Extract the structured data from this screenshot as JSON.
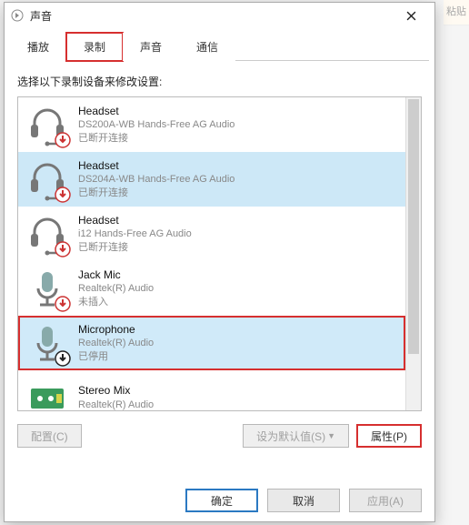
{
  "rightstrip": "粘贴",
  "title": "声音",
  "tabs": [
    {
      "label": "播放"
    },
    {
      "label": "录制",
      "active": true,
      "highlight": true
    },
    {
      "label": "声音"
    },
    {
      "label": "通信"
    }
  ],
  "instruction": "选择以下录制设备来修改设置:",
  "devices": [
    {
      "name": "Headset",
      "sub": "DS200A-WB Hands-Free AG Audio",
      "status": "已断开连接",
      "icon": "headset",
      "badge": "down",
      "sel": false
    },
    {
      "name": "Headset",
      "sub": "DS204A-WB Hands-Free AG Audio",
      "status": "已断开连接",
      "icon": "headset",
      "badge": "down",
      "sel": true
    },
    {
      "name": "Headset",
      "sub": "i12 Hands-Free AG Audio",
      "status": "已断开连接",
      "icon": "headset",
      "badge": "down",
      "sel": false
    },
    {
      "name": "Jack Mic",
      "sub": "Realtek(R) Audio",
      "status": "未插入",
      "icon": "mic",
      "badge": "down",
      "sel": false
    },
    {
      "name": "Microphone",
      "sub": "Realtek(R) Audio",
      "status": "已停用",
      "icon": "mic",
      "badge": "arrowdown",
      "sel": true,
      "hl": true
    },
    {
      "name": "Stereo Mix",
      "sub": "Realtek(R) Audio",
      "status": "",
      "icon": "board",
      "badge": "",
      "sel": false
    }
  ],
  "buttons": {
    "configure": "配置(C)",
    "setdefault": "设为默认值(S)",
    "properties": "属性(P)"
  },
  "dialogButtons": {
    "ok": "确定",
    "cancel": "取消",
    "apply": "应用(A)"
  }
}
